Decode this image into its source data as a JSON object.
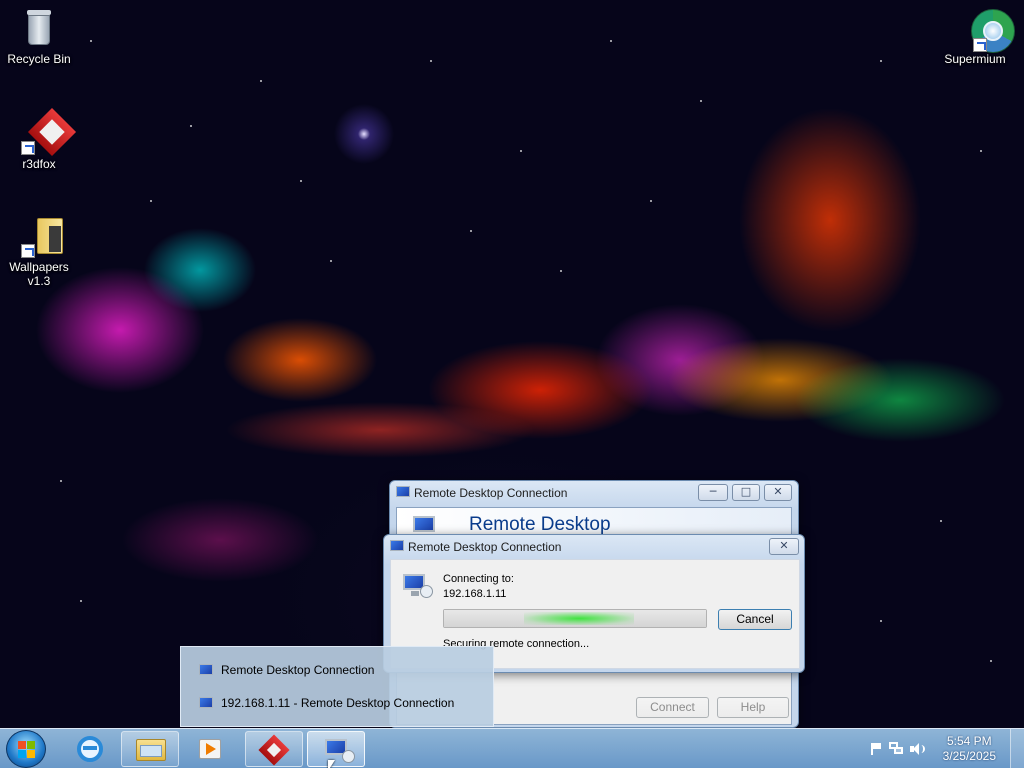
{
  "desktop": {
    "icons": [
      {
        "label": "Recycle Bin",
        "icon": "recycle-bin-icon"
      },
      {
        "label": "r3dfox",
        "icon": "r3dfox-icon"
      },
      {
        "label": "Wallpapers",
        "label2": "v1.3",
        "icon": "folder-icon"
      },
      {
        "label": "Supermium",
        "icon": "supermium-icon"
      }
    ]
  },
  "rdc_main": {
    "title": "Remote Desktop Connection",
    "banner": "Remote Desktop",
    "connect_label": "Connect",
    "help_label": "Help"
  },
  "rdc_progress": {
    "title": "Remote Desktop Connection",
    "connecting_label": "Connecting to:",
    "host": "192.168.1.11",
    "cancel_label": "Cancel",
    "status": "Securing remote connection...",
    "progress": 0.55
  },
  "jumplist": {
    "items": [
      {
        "label": "Remote Desktop Connection"
      },
      {
        "label": "192.168.1.11 - Remote Desktop Connection"
      }
    ]
  },
  "taskbar": {
    "pinned": [
      "internet-explorer-icon",
      "windows-explorer-icon",
      "media-player-icon",
      "r3dfox-icon",
      "remote-desktop-icon"
    ],
    "active": "remote-desktop-icon"
  },
  "tray": {
    "time": "5:54 PM",
    "date": "3/25/2025"
  }
}
